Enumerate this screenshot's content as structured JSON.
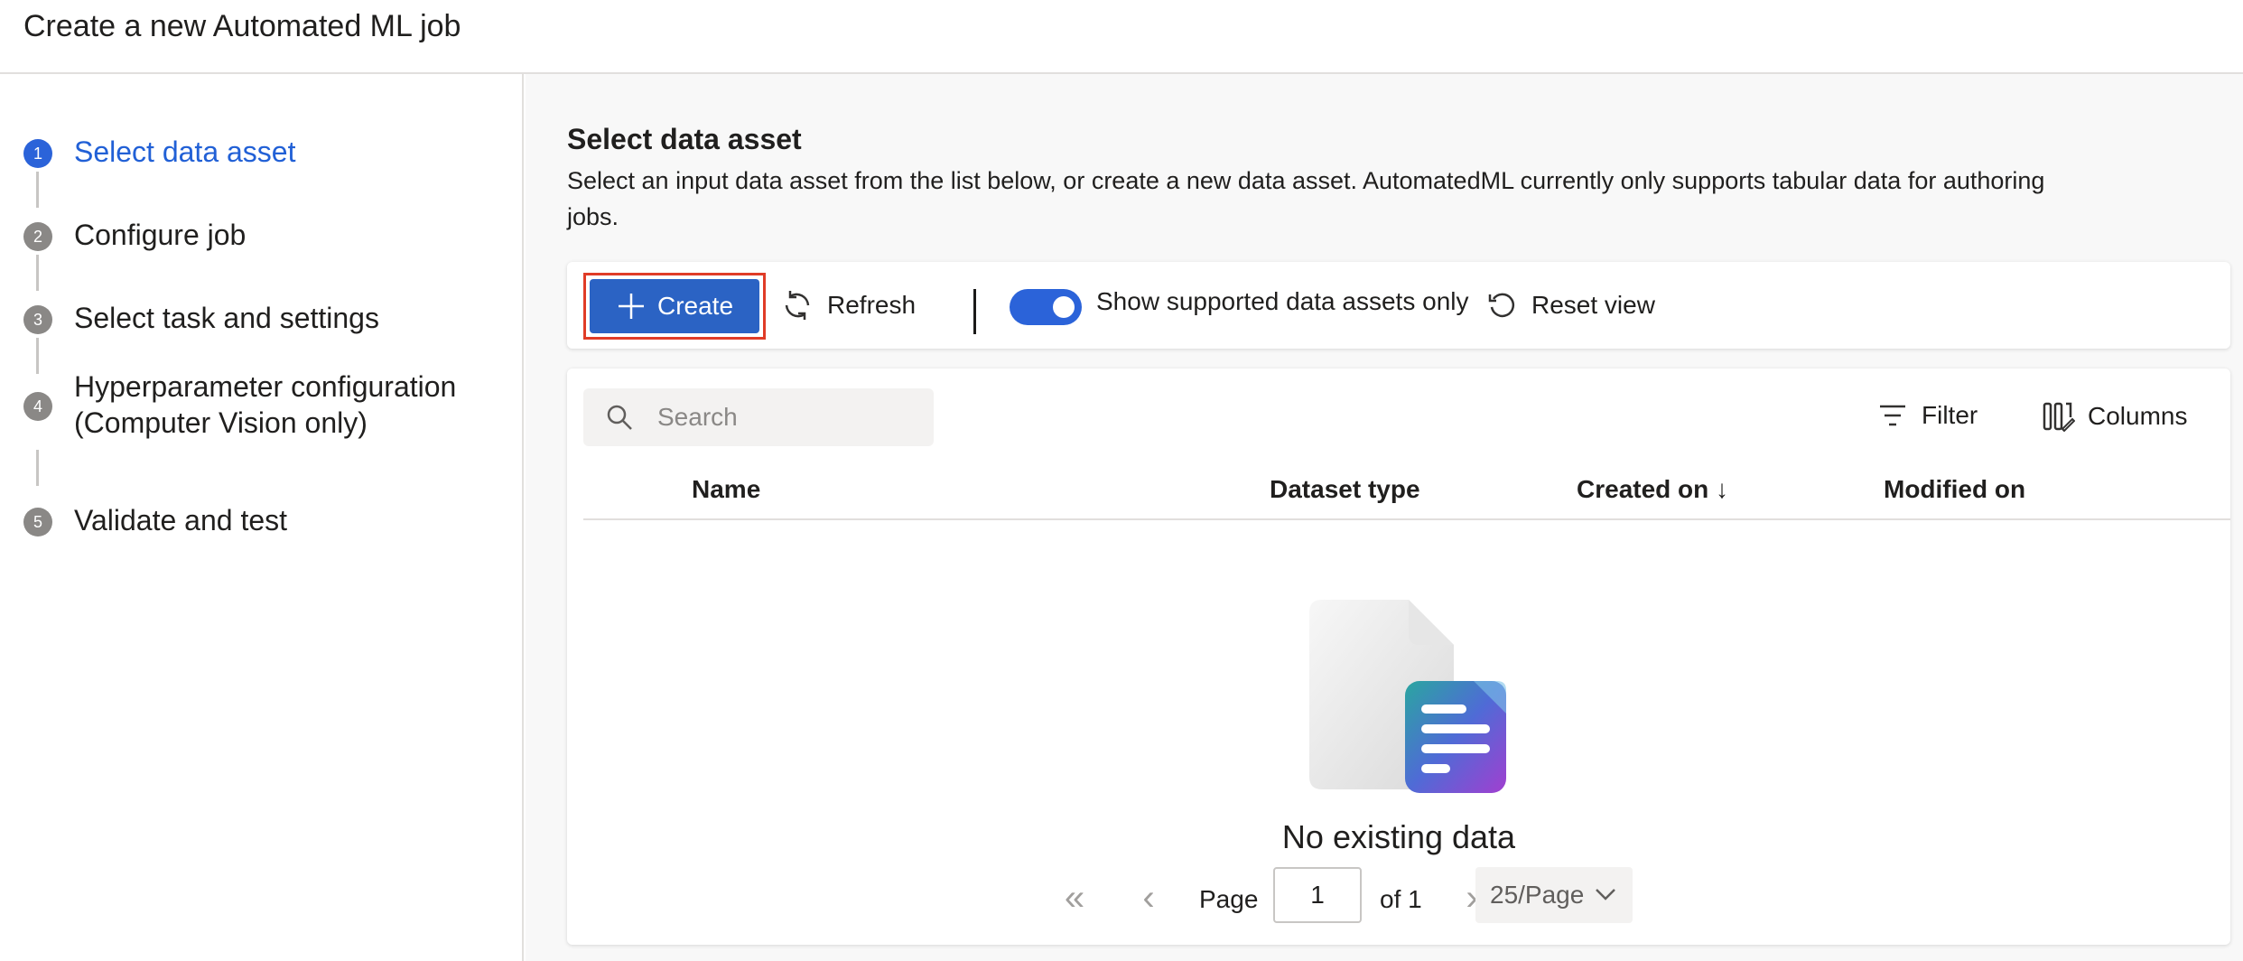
{
  "header": {
    "title": "Create a new Automated ML job"
  },
  "steps": [
    {
      "num": "1",
      "label": "Select data asset",
      "active": true
    },
    {
      "num": "2",
      "label": "Configure job"
    },
    {
      "num": "3",
      "label": "Select task and settings"
    },
    {
      "num": "4",
      "label_line1": "Hyperparameter configuration",
      "label_line2": "(Computer Vision only)"
    },
    {
      "num": "5",
      "label": "Validate and test"
    }
  ],
  "main": {
    "title": "Select data asset",
    "description": "Select an input data asset from the list below, or create a new data asset. AutomatedML currently only supports tabular data for authoring jobs."
  },
  "toolbar": {
    "create_label": "Create",
    "refresh_label": "Refresh",
    "toggle_on": true,
    "toggle_label": "Show supported data assets only",
    "reset_label": "Reset view"
  },
  "table": {
    "search_placeholder": "Search",
    "filter_label": "Filter",
    "columns_label": "Columns",
    "headers": [
      "Name",
      "Dataset type",
      "Created on ↓",
      "Modified on"
    ],
    "empty_text": "No existing data"
  },
  "pager": {
    "page_label": "Page",
    "page_value": "1",
    "of_label": "of 1",
    "page_size": "25/Page"
  },
  "colors": {
    "accent": "#2b63d9",
    "highlight": "#e03c27"
  }
}
